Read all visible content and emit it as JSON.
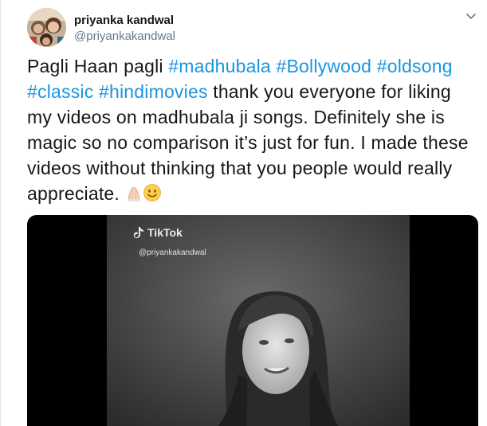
{
  "user": {
    "name": "priyanka kandwal",
    "handle": "@priyankakandwal"
  },
  "tweet": {
    "segments": [
      {
        "text": "Pagli Haan pagli ",
        "type": "text"
      },
      {
        "text": "#madhubala",
        "type": "hashtag"
      },
      {
        "text": " ",
        "type": "text"
      },
      {
        "text": "#Bollywood",
        "type": "hashtag"
      },
      {
        "text": " ",
        "type": "text"
      },
      {
        "text": "#oldsong",
        "type": "hashtag"
      },
      {
        "text": "  ",
        "type": "text"
      },
      {
        "text": "#classic",
        "type": "hashtag"
      },
      {
        "text": " ",
        "type": "text"
      },
      {
        "text": "#hindimovies",
        "type": "hashtag"
      },
      {
        "text": " thank you everyone for liking my videos on madhubala ji songs. Definitely she is magic so no comparison it’s just for fun. I made these videos without thinking that you people would really appreciate. ",
        "type": "text"
      }
    ],
    "emojis": [
      "folded-hands",
      "smiling-face"
    ]
  },
  "media": {
    "watermark_brand": "TikTok",
    "watermark_user": "@priyankakandwal"
  },
  "colors": {
    "hashtag": "#1b95e0",
    "secondary_text": "#657786",
    "border": "#e1e8ed"
  }
}
